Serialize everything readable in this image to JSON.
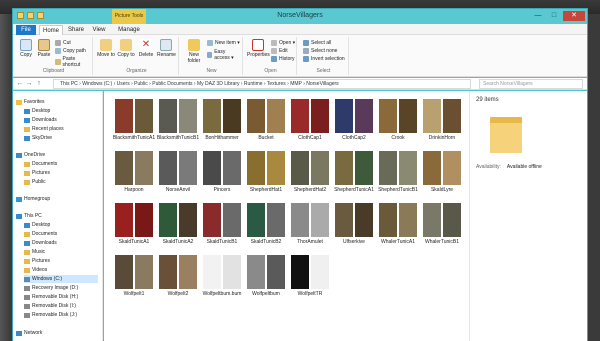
{
  "window": {
    "title": "NorseVillagers",
    "tools_tab": "Picture Tools",
    "minimize": "—",
    "maximize": "□",
    "close": "✕"
  },
  "tabs": [
    "File",
    "Home",
    "Share",
    "View",
    "Manage"
  ],
  "ribbon": {
    "clipboard": {
      "label": "Clipboard",
      "copy": "Copy",
      "paste": "Paste",
      "cut": "Cut",
      "copy_path": "Copy path",
      "paste_shortcut": "Paste shortcut"
    },
    "organize": {
      "label": "Organize",
      "move_to": "Move to",
      "copy_to": "Copy to",
      "delete": "Delete",
      "rename": "Rename"
    },
    "new": {
      "label": "New",
      "new_folder": "New folder",
      "new_item": "New item ▾",
      "easy_access": "Easy access ▾"
    },
    "open": {
      "label": "Open",
      "properties": "Properties",
      "open": "Open ▾",
      "edit": "Edit",
      "history": "History"
    },
    "select": {
      "label": "Select",
      "select_all": "Select all",
      "select_none": "Select none",
      "invert": "Invert selection"
    }
  },
  "address": {
    "path": "This PC  ›  Windows (C:)  ›  Users  ›  Public  ›  Public Documents  ›  My DAZ 3D Library  ›  Runtime  ›  Textures  ›  MMP  ›  NorseVillagers",
    "search_placeholder": "Search NorseVillagers"
  },
  "nav": {
    "favorites": "Favorites",
    "desktop": "Desktop",
    "downloads": "Downloads",
    "recent": "Recent places",
    "skydrive": "SkyDrive",
    "onedrive": "OneDrive",
    "od_documents": "Documents",
    "od_pictures": "Pictures",
    "od_public": "Public",
    "homegroup": "Homegroup",
    "thispc": "This PC",
    "pc_desktop": "Desktop",
    "pc_documents": "Documents",
    "pc_downloads": "Downloads",
    "pc_music": "Music",
    "pc_pictures": "Pictures",
    "pc_videos": "Videos",
    "windows_c": "Windows (C:)",
    "recovery_d": "Recovery Image (D:)",
    "removable_h": "Removable Disk (H:)",
    "removable_i": "Removable Disk (I:)",
    "removable_j": "Removable Disk (J:)",
    "network": "Network"
  },
  "files": [
    {
      "name": "BlacksmithTunicA1",
      "c1": "#8a3b2a",
      "c2": "#6b5a3a"
    },
    {
      "name": "BlacksmithTunicB1",
      "c1": "#5a5a52",
      "c2": "#8a8878"
    },
    {
      "name": "BonHithammer",
      "c1": "#7a6a40",
      "c2": "#4a3a22"
    },
    {
      "name": "Bucket",
      "c1": "#7a5a30",
      "c2": "#a08050"
    },
    {
      "name": "ClothCap1",
      "c1": "#9a2a2a",
      "c2": "#7a1e1e"
    },
    {
      "name": "ClothCap2",
      "c1": "#2e3a6a",
      "c2": "#5a3a5a"
    },
    {
      "name": "Crook",
      "c1": "#8a6a3a",
      "c2": "#5a4428"
    },
    {
      "name": "DrinkinHorn",
      "c1": "#b8a070",
      "c2": "#6a5030"
    },
    {
      "name": "Harpoon",
      "c1": "#6a5a40",
      "c2": "#8a7a60"
    },
    {
      "name": "NorseAnvil",
      "c1": "#5a5a5a",
      "c2": "#7a7a7a"
    },
    {
      "name": "Pincers",
      "c1": "#4a4a4a",
      "c2": "#6a6a6a"
    },
    {
      "name": "ShepherdHat1",
      "c1": "#8a6e30",
      "c2": "#a8893e"
    },
    {
      "name": "ShepherdHat2",
      "c1": "#5a5a48",
      "c2": "#7a7860"
    },
    {
      "name": "ShepherdTunicA1",
      "c1": "#7a6a40",
      "c2": "#3e5a3a"
    },
    {
      "name": "ShepherdTunicB1",
      "c1": "#6a6a58",
      "c2": "#8a8a72"
    },
    {
      "name": "SkaldLyre",
      "c1": "#8a6a3a",
      "c2": "#b09060"
    },
    {
      "name": "SkaldTunicA1",
      "c1": "#9a2020",
      "c2": "#7a1818"
    },
    {
      "name": "SkaldTunicA2",
      "c1": "#2e5a3a",
      "c2": "#4a3a2a"
    },
    {
      "name": "SkaldTunicB1",
      "c1": "#8a2a2a",
      "c2": "#6a6a6a"
    },
    {
      "name": "SkaldTunicB2",
      "c1": "#2a5a44",
      "c2": "#6a6a6a"
    },
    {
      "name": "ThorAmulet",
      "c1": "#8a8a8a",
      "c2": "#aaaaaa"
    },
    {
      "name": "Ulfserkive",
      "c1": "#6a5a40",
      "c2": "#4a3a28"
    },
    {
      "name": "WhalerTunicA1",
      "c1": "#6a5a3a",
      "c2": "#8a7a58"
    },
    {
      "name": "WhalerTunicB1",
      "c1": "#7a7868",
      "c2": "#5a5848"
    },
    {
      "name": "Wolfpelt1",
      "c1": "#5a4a38",
      "c2": "#8a7a60"
    },
    {
      "name": "Wolfpelt2",
      "c1": "#6a5038",
      "c2": "#9a8060"
    },
    {
      "name": "Wolfpeltbum.bum",
      "c1": "#f2f2f2",
      "c2": "#e2e2e2"
    },
    {
      "name": "Wolfpeltbum",
      "c1": "#8a8a8a",
      "c2": "#5a5a5a"
    },
    {
      "name": "WolfpeltTR",
      "c1": "#111111",
      "c2": "#f0f0f0"
    }
  ],
  "details": {
    "count": "29 items",
    "availability_label": "Availability:",
    "availability_value": "Available offline"
  }
}
